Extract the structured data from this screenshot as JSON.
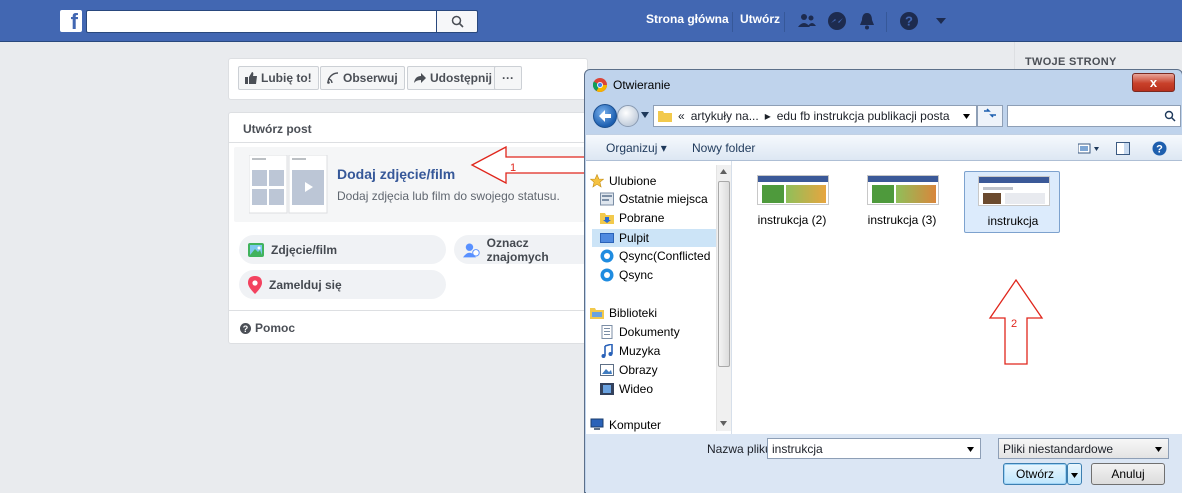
{
  "fb": {
    "logo": "f",
    "search_placeholder": "",
    "nav": {
      "home": "Strona główna",
      "create": "Utwórz"
    },
    "actions": {
      "like": "Lubię to!",
      "follow": "Obserwuj",
      "share": "Udostępnij",
      "more": "···"
    },
    "post": {
      "title": "Utwórz post",
      "photo_main": "Dodaj zdjęcie/film",
      "photo_sub": "Dodaj zdjęcia lub film do swojego statusu.",
      "photo_video": "Zdjęcie/film",
      "tag_friends": "Oznacz znajomych",
      "check_in": "Zamelduj się",
      "help": "Pomoc"
    },
    "right_title": "TWOJE STRONY"
  },
  "annotations": {
    "arrow1": "1",
    "arrow2": "2",
    "color": "#e0261c"
  },
  "dialog": {
    "title": "Otwieranie",
    "close": "x",
    "path": [
      "«",
      "artykuły na...",
      "▸",
      "edu fb instrukcja publikacji posta"
    ],
    "toolbar": {
      "organize": "Organizuj ▾",
      "new_folder": "Nowy folder"
    },
    "nav": {
      "favorites": "Ulubione",
      "recent": "Ostatnie miejsca",
      "downloads": "Pobrane",
      "desktop": "Pulpit",
      "qsync_conflict": "Qsync(Conflicted",
      "qsync": "Qsync",
      "libraries": "Biblioteki",
      "documents": "Dokumenty",
      "music": "Muzyka",
      "pictures": "Obrazy",
      "video": "Wideo",
      "computer": "Komputer"
    },
    "files": [
      "instrukcja (2)",
      "instrukcja (3)",
      "instrukcja"
    ],
    "filename_label": "Nazwa pliku:",
    "filename": "instrukcja",
    "filetype": "Pliki niestandardowe",
    "open": "Otwórz",
    "cancel": "Anuluj"
  }
}
